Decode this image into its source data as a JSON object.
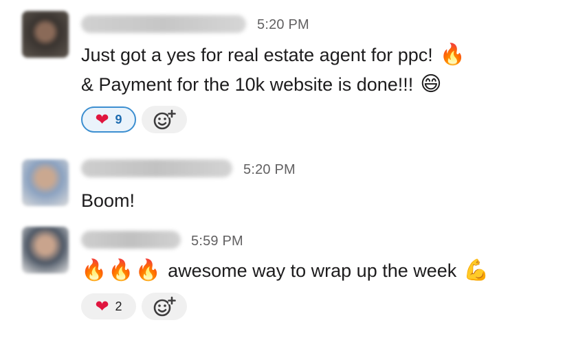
{
  "messages": [
    {
      "time": "5:20 PM",
      "lines": [
        {
          "text": "Just got a yes for real estate agent for ppc!",
          "emoji": "🔥"
        },
        {
          "text": "& Payment for the 10k website is done!!!",
          "emoji": "😄"
        }
      ],
      "reaction": {
        "emoji": "❤",
        "count": "9",
        "reacted": true
      }
    },
    {
      "time": "5:20 PM",
      "lines": [
        {
          "text": "Boom!"
        }
      ]
    },
    {
      "time": "5:59 PM",
      "lines": [
        {
          "prefix_emoji": "🔥🔥🔥",
          "text": "awesome way to wrap up the week",
          "emoji": "💪"
        }
      ],
      "reaction": {
        "emoji": "❤",
        "count": "2",
        "reacted": false
      }
    }
  ],
  "icons": {
    "add_reaction": "add-reaction-icon",
    "heart": "heart-icon"
  },
  "colors": {
    "active_reaction_border": "#3b8ed0",
    "active_reaction_bg": "#eaf3fb",
    "heart": "#e0163f"
  }
}
